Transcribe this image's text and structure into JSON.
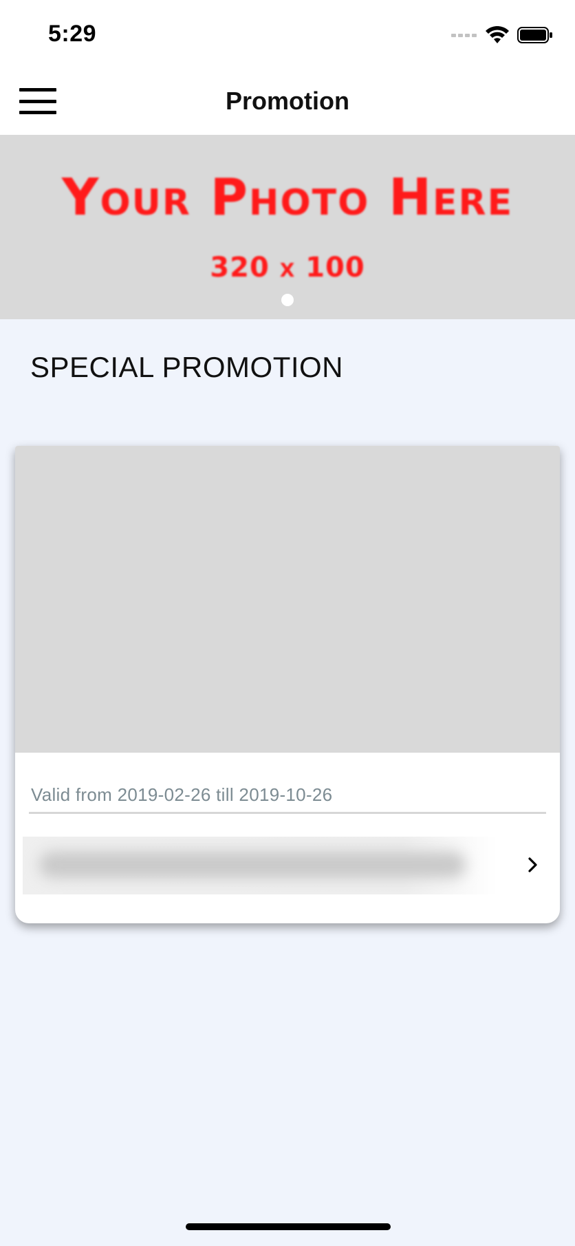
{
  "status_bar": {
    "time": "5:29",
    "icons": [
      "cellular-signal-icon",
      "wifi-icon",
      "battery-icon"
    ]
  },
  "nav": {
    "title": "Promotion",
    "menu_icon": "hamburger-menu-icon"
  },
  "banner": {
    "line1": "Your Photo Here",
    "line2": "320 x 100",
    "text_color": "#ff1a1a",
    "page_indicator": {
      "count": 1,
      "active_index": 0
    }
  },
  "section": {
    "title": "SPECIAL PROMOTION"
  },
  "promo_card": {
    "valid_text": "Valid from 2019-02-26 till 2019-10-26",
    "chevron_icon": "chevron-right-icon"
  },
  "colors": {
    "background": "#f0f4fc",
    "placeholder": "#d9d9d9",
    "muted_text": "#7c8b92"
  }
}
